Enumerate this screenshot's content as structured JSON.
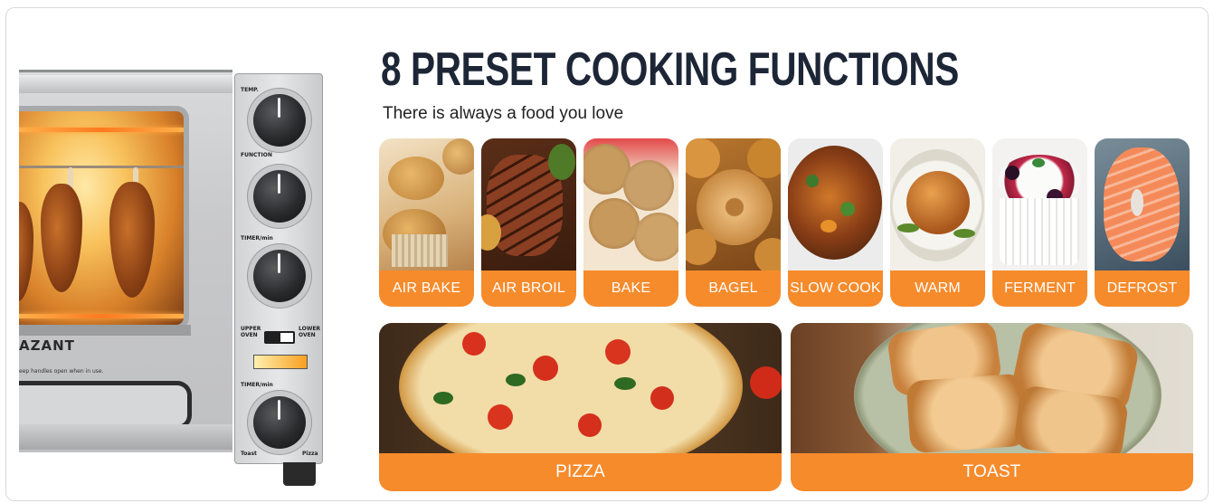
{
  "header": {
    "title": "8 PRESET COOKING FUNCTIONS",
    "subtitle": "There is always a food you love"
  },
  "oven": {
    "brand": "AZANT",
    "warning": "eep handles open when in use.",
    "panel": {
      "temp": "TEMP.",
      "function": "FUNCTION",
      "timer": "TIMER/min",
      "upper": "UPPER OVEN",
      "lower": "LOWER OVEN",
      "timer2": "TIMER/min",
      "toast": "Toast",
      "pizza": "Pizza"
    }
  },
  "functions": [
    {
      "label": "AIR BAKE",
      "icon": "muffin-photo"
    },
    {
      "label": "AIR BROIL",
      "icon": "steak-photo"
    },
    {
      "label": "BAKE",
      "icon": "cookie-photo"
    },
    {
      "label": "BAGEL",
      "icon": "bagel-photo"
    },
    {
      "label": "SLOW COOK",
      "icon": "stew-photo"
    },
    {
      "label": "WARM",
      "icon": "roast-chicken-photo"
    },
    {
      "label": "FERMENT",
      "icon": "yogurt-photo"
    },
    {
      "label": "DEFROST",
      "icon": "salmon-photo"
    }
  ],
  "featured": [
    {
      "label": "PIZZA",
      "icon": "pizza-photo"
    },
    {
      "label": "TOAST",
      "icon": "toast-photo"
    }
  ],
  "colors": {
    "accent": "#f68b2c",
    "title": "#1d2636"
  }
}
